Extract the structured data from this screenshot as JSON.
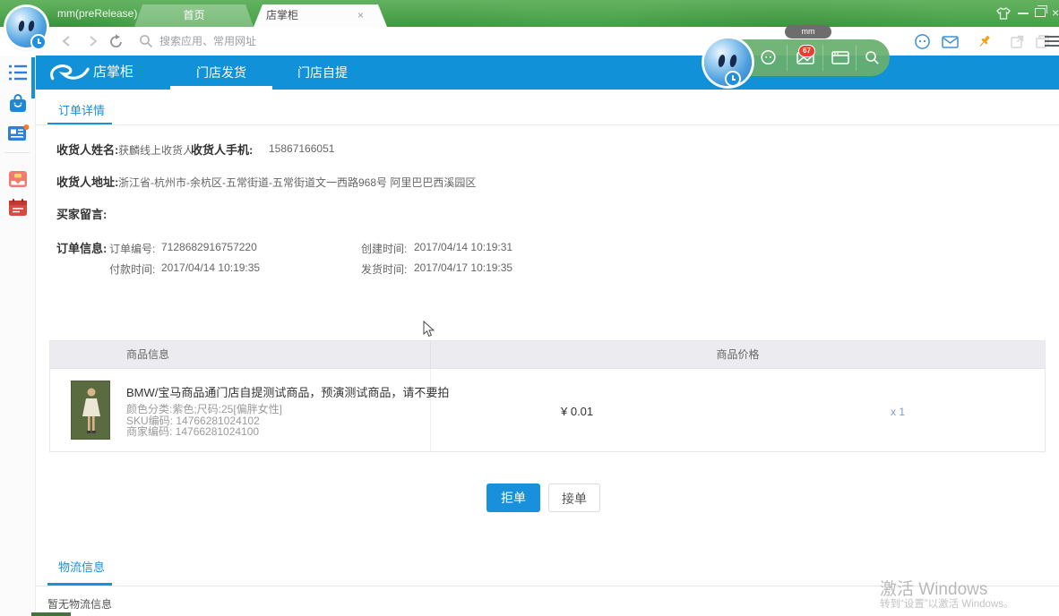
{
  "colors": {
    "titlebar_green": "#46a046",
    "nav_blue": "#1191d8",
    "accent_blue": "#1890db",
    "badge_red": "#f03b30"
  },
  "browser": {
    "window_title": "mm(preRelease)",
    "tooltip": "mm",
    "tabs": [
      {
        "label": "首页"
      },
      {
        "label": "店掌柜"
      }
    ],
    "search_placeholder": "搜索应用、常用网址",
    "mail_badge": "67"
  },
  "nav": {
    "app_title": "店掌柜",
    "menu": [
      {
        "label": "门店发货"
      },
      {
        "label": "门店自提"
      }
    ]
  },
  "order": {
    "section_title": "订单详情",
    "receiver_name_label": "收货人姓名:",
    "receiver_name": "获麟线上收货人",
    "receiver_phone_label": "收货人手机:",
    "receiver_phone": "15867166051",
    "address_label": "收货人地址:",
    "address": "浙江省-杭州市-余杭区-五常街道-五常街道文一西路968号 阿里巴巴西溪园区",
    "buyer_message_label": "买家留言:",
    "order_info_label": "订单信息:",
    "order_no_label": "订单编号:",
    "order_no": "7128682916757220",
    "created_label": "创建时间:",
    "created_time": "2017/04/14 10:19:31",
    "paid_label": "付款时间:",
    "paid_time": "2017/04/14 10:19:35",
    "shipped_label": "发货时间:",
    "shipped_time": "2017/04/17 10:19:35"
  },
  "product_table": {
    "headers": [
      "商品信息",
      "商品价格"
    ],
    "row": {
      "title": "BMW/宝马商品通门店自提测试商品，预演测试商品，请不要拍",
      "attr_color_size": "颜色分类:紫色;尺码:25[偏胖女性]",
      "sku_code": "SKU编码: 14766281024102",
      "merchant_code": "商家编码: 14766281024100",
      "price": "¥ 0.01",
      "quantity": "x 1"
    }
  },
  "actions": {
    "reject_label": "拒单",
    "accept_label": "接单"
  },
  "logistics": {
    "section_title": "物流信息",
    "empty_text": "暂无物流信息"
  },
  "watermark": {
    "line1": "激活 Windows",
    "line2": "转到“设置”以激活 Windows。"
  },
  "icons": {
    "tab_close": "×",
    "minimize_glyph": "–",
    "close_glyph": "×"
  }
}
